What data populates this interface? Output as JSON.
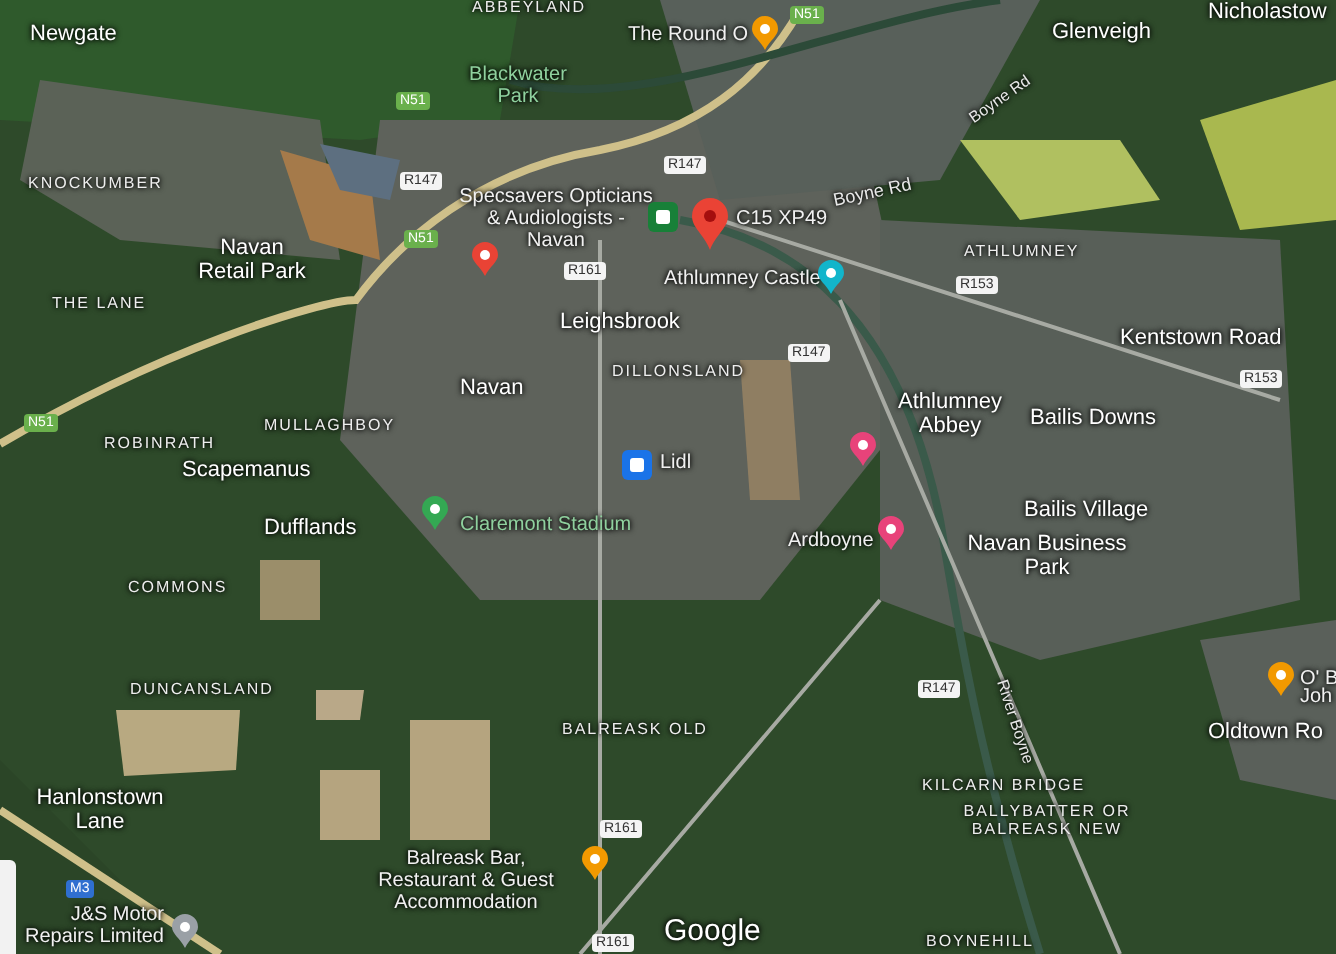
{
  "map": {
    "labels": [
      {
        "kind": "district",
        "text": "ABBEYLAND"
      },
      {
        "kind": "national-shield",
        "text": "N51"
      },
      {
        "kind": "town",
        "text": "Nicholastow"
      },
      {
        "kind": "town",
        "text": "Newgate"
      },
      {
        "kind": "poi",
        "text": "The Round O"
      },
      {
        "kind": "town",
        "text": "Glenveigh"
      },
      {
        "kind": "national-shield",
        "text": "N51"
      },
      {
        "kind": "park",
        "text": "Blackwater Park"
      },
      {
        "kind": "national-shield",
        "text": "N51"
      },
      {
        "kind": "national-shield",
        "text": "N51"
      },
      {
        "kind": "regional-shield",
        "text": "R147"
      },
      {
        "kind": "regional-shield",
        "text": "R147"
      },
      {
        "kind": "regional-shield",
        "text": "R147"
      },
      {
        "kind": "regional-shield",
        "text": "R147"
      },
      {
        "kind": "regional-shield",
        "text": "R161"
      },
      {
        "kind": "regional-shield",
        "text": "R161"
      },
      {
        "kind": "regional-shield",
        "text": "R161"
      },
      {
        "kind": "regional-shield",
        "text": "R153"
      },
      {
        "kind": "regional-shield",
        "text": "R153"
      },
      {
        "kind": "street",
        "text": "Boyne Rd"
      },
      {
        "kind": "street",
        "text": "Boyne Rd"
      },
      {
        "kind": "district",
        "text": "KNOCKUMBER"
      },
      {
        "kind": "poi",
        "text": "Specsavers Opticians & Audiologists - Navan"
      },
      {
        "kind": "poi",
        "text": "C15 XP49"
      },
      {
        "kind": "poi",
        "text": "Athlumney Castle"
      },
      {
        "kind": "district",
        "text": "ATHLUMNEY"
      },
      {
        "kind": "town",
        "text": "Navan Retail Park"
      },
      {
        "kind": "district",
        "text": "THE LANE"
      },
      {
        "kind": "town",
        "text": "Leighsbrook"
      },
      {
        "kind": "district",
        "text": "DILLONSLAND"
      },
      {
        "kind": "town",
        "text": "Kentstown Road"
      },
      {
        "kind": "town",
        "text": "Navan"
      },
      {
        "kind": "town",
        "text": "Athlumney Abbey"
      },
      {
        "kind": "town",
        "text": "Bailis Downs"
      },
      {
        "kind": "district",
        "text": "MULLAGHBOY"
      },
      {
        "kind": "district",
        "text": "ROBINRATH"
      },
      {
        "kind": "town",
        "text": "Scapemanus"
      },
      {
        "kind": "poi",
        "text": "Lidl"
      },
      {
        "kind": "town",
        "text": "Dufflands"
      },
      {
        "kind": "park",
        "text": "Claremont Stadium"
      },
      {
        "kind": "town",
        "text": "Bailis Village"
      },
      {
        "kind": "poi",
        "text": "Ardboyne"
      },
      {
        "kind": "town",
        "text": "Navan Business Park"
      },
      {
        "kind": "district",
        "text": "COMMONS"
      },
      {
        "kind": "district",
        "text": "DUNCANSLAND"
      },
      {
        "kind": "district",
        "text": "BALREASK OLD"
      },
      {
        "kind": "street",
        "text": "River Boyne"
      },
      {
        "kind": "poi",
        "text": "O' B"
      },
      {
        "kind": "poi",
        "text": "Joh"
      },
      {
        "kind": "town",
        "text": "Oldtown Ro"
      },
      {
        "kind": "town",
        "text": "Hanlonstown Lane"
      },
      {
        "kind": "district",
        "text": "KILCARN BRIDGE"
      },
      {
        "kind": "district",
        "text": "BALLYBATTER OR BALREASK NEW"
      },
      {
        "kind": "motorway-shield",
        "text": "M3"
      },
      {
        "kind": "poi",
        "text": "J&S Motor Repairs Limited"
      },
      {
        "kind": "poi",
        "text": "Balreask Bar, Restaurant & Guest Accommodation"
      },
      {
        "kind": "logo",
        "text": "Google"
      },
      {
        "kind": "district",
        "text": "BOYNEHILL"
      }
    ],
    "pins": [
      {
        "kind": "drop",
        "color": "#f29900"
      },
      {
        "kind": "drop",
        "color": "#e94335"
      },
      {
        "kind": "square",
        "color": "#188038"
      },
      {
        "kind": "marker",
        "color": "#ea4335"
      },
      {
        "kind": "drop",
        "color": "#12b5cb"
      },
      {
        "kind": "drop",
        "color": "#34a853"
      },
      {
        "kind": "square",
        "color": "#1a73e8"
      },
      {
        "kind": "drop",
        "color": "#e8437a"
      },
      {
        "kind": "drop",
        "color": "#e8437a"
      },
      {
        "kind": "drop",
        "color": "#f29900"
      },
      {
        "kind": "drop",
        "color": "#f29900"
      },
      {
        "kind": "drop",
        "color": "#9aa0a6"
      }
    ]
  }
}
